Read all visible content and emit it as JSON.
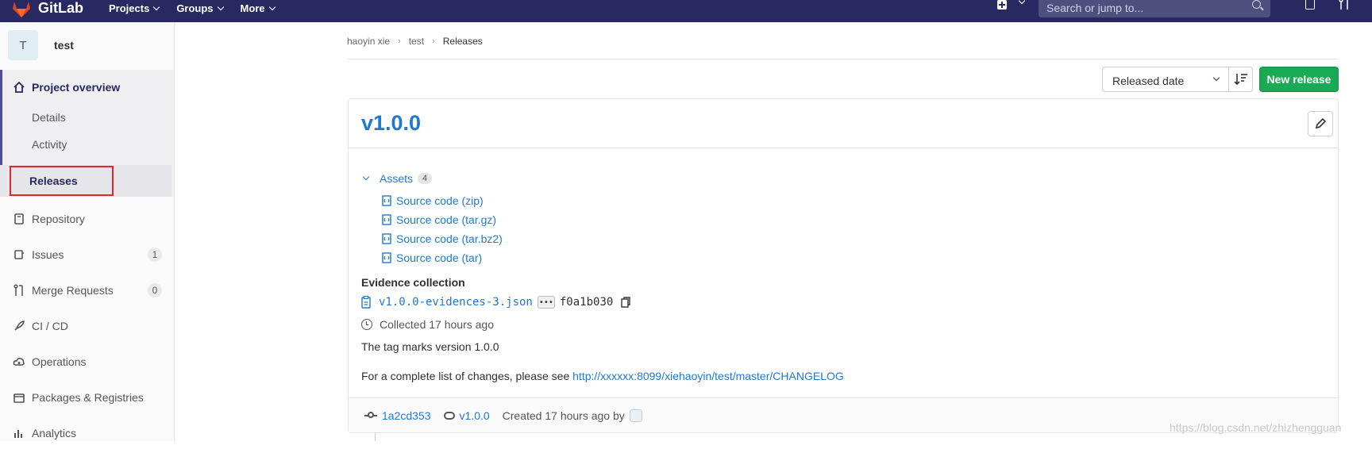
{
  "navbar": {
    "brand": "GitLab",
    "menu": [
      "Projects",
      "Groups",
      "More"
    ],
    "search_placeholder": "Search or jump to..."
  },
  "sidebar": {
    "project_initial": "T",
    "project_name": "test",
    "overview": {
      "title": "Project overview",
      "items": [
        "Details",
        "Activity",
        "Releases"
      ]
    },
    "items": [
      {
        "label": "Repository",
        "icon": "book-icon"
      },
      {
        "label": "Issues",
        "icon": "issues-icon",
        "count": "1"
      },
      {
        "label": "Merge Requests",
        "icon": "merge-request-icon",
        "count": "0"
      },
      {
        "label": "CI / CD",
        "icon": "rocket-icon"
      },
      {
        "label": "Operations",
        "icon": "cloud-gear-icon"
      },
      {
        "label": "Packages & Registries",
        "icon": "package-icon"
      },
      {
        "label": "Analytics",
        "icon": "chart-icon"
      }
    ]
  },
  "breadcrumb": [
    "haoyin xie",
    "test",
    "Releases"
  ],
  "toolbar": {
    "sort_value": "Released date",
    "new_release": "New release"
  },
  "release": {
    "title": "v1.0.0",
    "assets_label": "Assets",
    "assets_count": "4",
    "assets": [
      "Source code (zip)",
      "Source code (tar.gz)",
      "Source code (tar.bz2)",
      "Source code (tar)"
    ],
    "evidence_title": "Evidence collection",
    "evidence_file": "v1.0.0-evidences-3.json",
    "evidence_ellipsis": "•••",
    "evidence_sha": "f0a1b030",
    "collected": "Collected 17 hours ago",
    "description": "The tag marks version 1.0.0",
    "changes_prefix": "For a complete list of changes, please see ",
    "changes_link": "http://xxxxxx:8099/xiehaoyin/test/master/CHANGELOG",
    "commit": "1a2cd353",
    "tag": "v1.0.0",
    "created": "Created 17 hours ago by"
  },
  "watermark": "https://blog.csdn.net/zhizhengguan",
  "colors": {
    "navbar": "#292961",
    "link": "#1f78d1",
    "primary_button": "#1aaa55",
    "highlight_border": "#e0272c"
  }
}
